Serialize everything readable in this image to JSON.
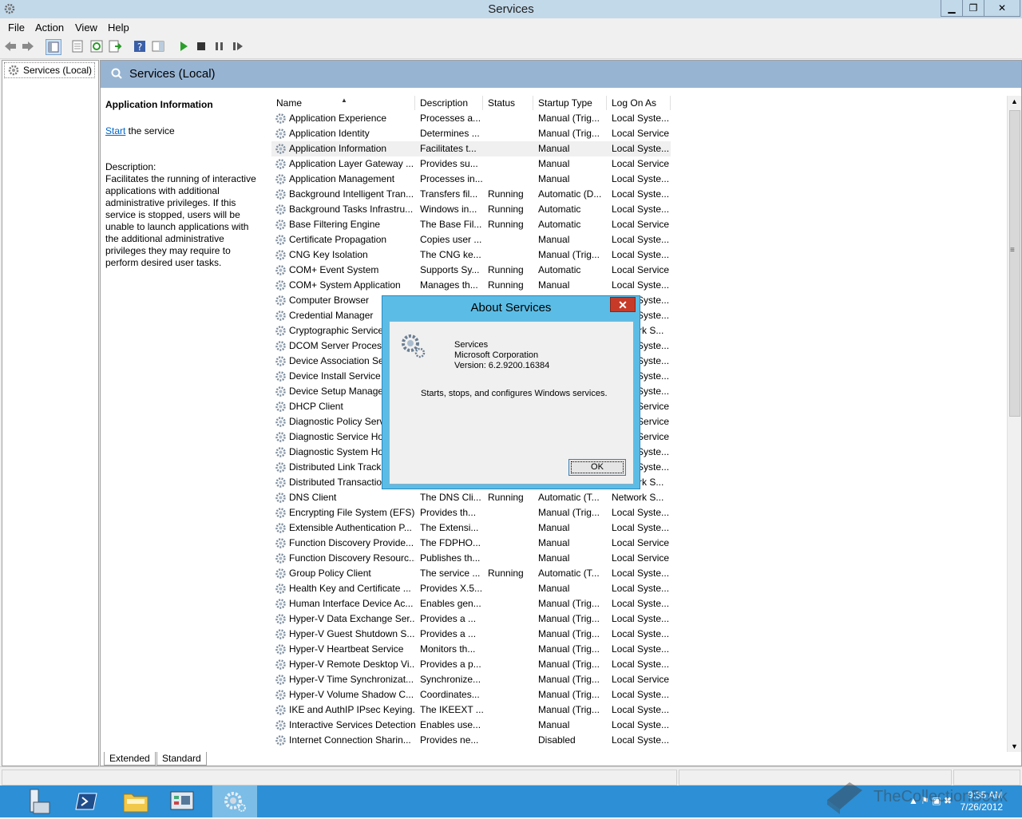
{
  "window": {
    "title": "Services",
    "minimize": "▁",
    "maximize": "❐",
    "close": "✕"
  },
  "menu": [
    "File",
    "Action",
    "View",
    "Help"
  ],
  "tree": {
    "item": "Services (Local)"
  },
  "content": {
    "title": "Services (Local)",
    "info": {
      "heading": "Application Information",
      "link": "Start",
      "link_suffix": " the service",
      "desc_label": "Description:",
      "desc_text": "Facilitates the running of interactive applications with additional administrative privileges.  If this service is stopped, users will be unable to launch applications with the additional administrative privileges they may require to perform desired user tasks."
    },
    "columns": [
      "Name",
      "Description",
      "Status",
      "Startup Type",
      "Log On As"
    ],
    "sort_arrow": "▲",
    "rows": [
      [
        "Application Experience",
        "Processes a...",
        "",
        "Manual (Trig...",
        "Local Syste..."
      ],
      [
        "Application Identity",
        "Determines ...",
        "",
        "Manual (Trig...",
        "Local Service"
      ],
      [
        "Application Information",
        "Facilitates t...",
        "",
        "Manual",
        "Local Syste..."
      ],
      [
        "Application Layer Gateway ...",
        "Provides su...",
        "",
        "Manual",
        "Local Service"
      ],
      [
        "Application Management",
        "Processes in...",
        "",
        "Manual",
        "Local Syste..."
      ],
      [
        "Background Intelligent Tran...",
        "Transfers fil...",
        "Running",
        "Automatic (D...",
        "Local Syste..."
      ],
      [
        "Background Tasks Infrastru...",
        "Windows in...",
        "Running",
        "Automatic",
        "Local Syste..."
      ],
      [
        "Base Filtering Engine",
        "The Base Fil...",
        "Running",
        "Automatic",
        "Local Service"
      ],
      [
        "Certificate Propagation",
        "Copies user ...",
        "",
        "Manual",
        "Local Syste..."
      ],
      [
        "CNG Key Isolation",
        "The CNG ke...",
        "",
        "Manual (Trig...",
        "Local Syste..."
      ],
      [
        "COM+ Event System",
        "Supports Sy...",
        "Running",
        "Automatic",
        "Local Service"
      ],
      [
        "COM+ System Application",
        "Manages th...",
        "Running",
        "Manual",
        "Local Syste..."
      ],
      [
        "Computer Browser",
        "",
        "",
        "",
        "Local Syste..."
      ],
      [
        "Credential Manager",
        "",
        "",
        "",
        "Local Syste..."
      ],
      [
        "Cryptographic Services",
        "",
        "",
        "",
        "Network S..."
      ],
      [
        "DCOM Server Process",
        "",
        "",
        "",
        "Local Syste..."
      ],
      [
        "Device Association Ser",
        "",
        "",
        "",
        "Local Syste..."
      ],
      [
        "Device Install Service",
        "",
        "",
        "",
        "Local Syste..."
      ],
      [
        "Device Setup Manager",
        "",
        "",
        "",
        "Local Syste..."
      ],
      [
        "DHCP Client",
        "",
        "",
        "",
        "Local Service"
      ],
      [
        "Diagnostic Policy Serv",
        "",
        "",
        "",
        "Local Service"
      ],
      [
        "Diagnostic Service Ho",
        "",
        "",
        "",
        "Local Service"
      ],
      [
        "Diagnostic System Ho",
        "",
        "",
        "",
        "Local Syste..."
      ],
      [
        "Distributed Link Tracki",
        "",
        "",
        "",
        "Local Syste..."
      ],
      [
        "Distributed Transactio",
        "",
        "",
        "",
        "Network S..."
      ],
      [
        "DNS Client",
        "The DNS Cli...",
        "Running",
        "Automatic (T...",
        "Network S..."
      ],
      [
        "Encrypting File System (EFS)",
        "Provides th...",
        "",
        "Manual (Trig...",
        "Local Syste..."
      ],
      [
        "Extensible Authentication P...",
        "The Extensi...",
        "",
        "Manual",
        "Local Syste..."
      ],
      [
        "Function Discovery Provide...",
        "The FDPHO...",
        "",
        "Manual",
        "Local Service"
      ],
      [
        "Function Discovery Resourc...",
        "Publishes th...",
        "",
        "Manual",
        "Local Service"
      ],
      [
        "Group Policy Client",
        "The service ...",
        "Running",
        "Automatic (T...",
        "Local Syste..."
      ],
      [
        "Health Key and Certificate ...",
        "Provides X.5...",
        "",
        "Manual",
        "Local Syste..."
      ],
      [
        "Human Interface Device Ac...",
        "Enables gen...",
        "",
        "Manual (Trig...",
        "Local Syste..."
      ],
      [
        "Hyper-V Data Exchange Ser...",
        "Provides a ...",
        "",
        "Manual (Trig...",
        "Local Syste..."
      ],
      [
        "Hyper-V Guest Shutdown S...",
        "Provides a ...",
        "",
        "Manual (Trig...",
        "Local Syste..."
      ],
      [
        "Hyper-V Heartbeat Service",
        "Monitors th...",
        "",
        "Manual (Trig...",
        "Local Syste..."
      ],
      [
        "Hyper-V Remote Desktop Vi...",
        "Provides a p...",
        "",
        "Manual (Trig...",
        "Local Syste..."
      ],
      [
        "Hyper-V Time Synchronizat...",
        "Synchronize...",
        "",
        "Manual (Trig...",
        "Local Service"
      ],
      [
        "Hyper-V Volume Shadow C...",
        "Coordinates...",
        "",
        "Manual (Trig...",
        "Local Syste..."
      ],
      [
        "IKE and AuthIP IPsec Keying...",
        "The IKEEXT ...",
        "",
        "Manual (Trig...",
        "Local Syste..."
      ],
      [
        "Interactive Services Detection",
        "Enables use...",
        "",
        "Manual",
        "Local Syste..."
      ],
      [
        "Internet Connection Sharin...",
        "Provides ne...",
        "",
        "Disabled",
        "Local Syste..."
      ]
    ],
    "tabs": [
      "Extended",
      "Standard"
    ]
  },
  "dialog": {
    "title": "About Services",
    "close": "✕",
    "product": "Services",
    "company": "Microsoft Corporation",
    "version": "Version: 6.2.9200.16384",
    "description": "Starts, stops, and configures Windows services.",
    "ok": "OK"
  },
  "taskbar": {
    "time": "9:35 AM",
    "date": "7/26/2012"
  },
  "watermark": "TheCollectionBook",
  "colors": {
    "titlebar": "#c2d9ea",
    "header_band": "#97b4d3",
    "dialog_frame": "#5bbde6",
    "taskbar": "#2d8fd5",
    "close_red": "#c73a28"
  }
}
